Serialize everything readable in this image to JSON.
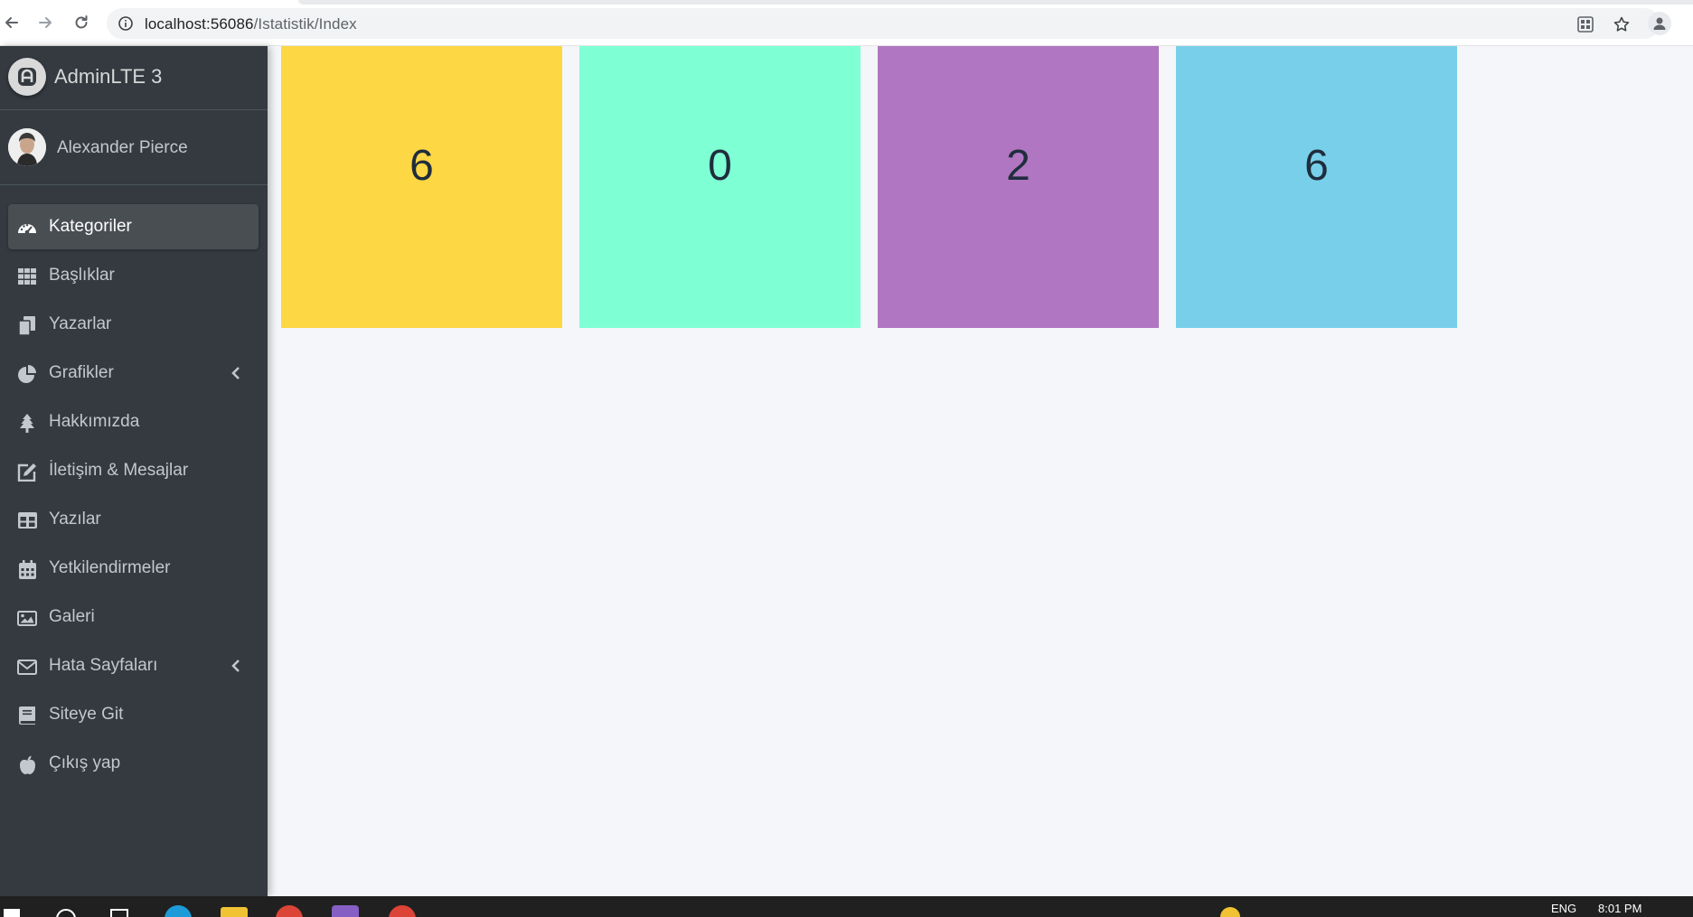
{
  "browser": {
    "url_host": "localhost:56086",
    "url_path": "/Istatistik/Index"
  },
  "sidebar": {
    "brand": "AdminLTE 3",
    "user": "Alexander Pierce",
    "items": [
      {
        "label": "Kategoriler",
        "icon": "tachometer-icon",
        "active": true
      },
      {
        "label": "Başlıklar",
        "icon": "th-grid-icon"
      },
      {
        "label": "Yazarlar",
        "icon": "copy-icon"
      },
      {
        "label": "Grafikler",
        "icon": "pie-chart-icon",
        "expandable": true
      },
      {
        "label": "Hakkımızda",
        "icon": "tree-icon"
      },
      {
        "label": "İletişim & Mesajlar",
        "icon": "edit-icon"
      },
      {
        "label": "Yazılar",
        "icon": "table-icon"
      },
      {
        "label": "Yetkilendirmeler",
        "icon": "calendar-icon"
      },
      {
        "label": "Galeri",
        "icon": "image-icon"
      },
      {
        "label": "Hata Sayfaları",
        "icon": "envelope-icon",
        "expandable": true
      },
      {
        "label": "Siteye Git",
        "icon": "book-icon"
      },
      {
        "label": "Çıkış yap",
        "icon": "apple-icon"
      }
    ]
  },
  "stats": [
    {
      "value": "6",
      "color": "#fdd744"
    },
    {
      "value": "0",
      "color": "#7fffd4"
    },
    {
      "value": "2",
      "color": "#b076c1"
    },
    {
      "value": "6",
      "color": "#78cfe9"
    }
  ],
  "taskbar": {
    "language": "ENG",
    "time": "8:01 PM"
  }
}
